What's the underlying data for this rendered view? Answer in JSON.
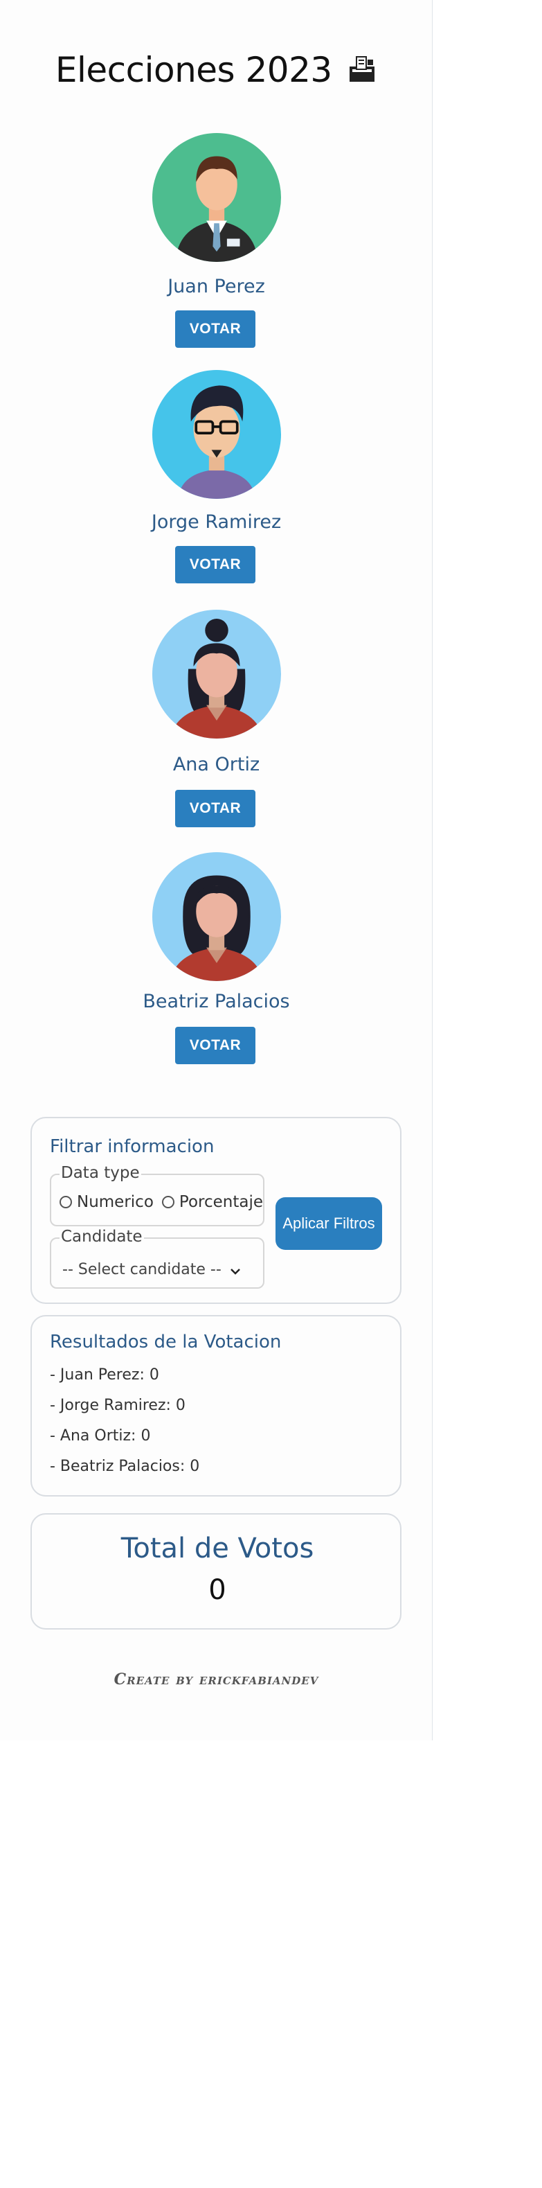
{
  "header": {
    "title": "Elecciones 2023",
    "title_icon": "ballot-box-icon"
  },
  "candidates": [
    {
      "name": "Juan Perez",
      "vote_label": "VOTAR",
      "avatar_bg": "#4dbd8f"
    },
    {
      "name": "Jorge Ramirez",
      "vote_label": "VOTAR",
      "avatar_bg": "#45c4ea"
    },
    {
      "name": "Ana Ortiz",
      "vote_label": "VOTAR",
      "avatar_bg": "#8fd0f5"
    },
    {
      "name": "Beatriz Palacios",
      "vote_label": "VOTAR",
      "avatar_bg": "#8fd0f5"
    }
  ],
  "filter": {
    "title": "Filtrar informacion",
    "data_type_legend": "Data type",
    "options": [
      "Numerico",
      "Porcentaje"
    ],
    "candidate_legend": "Candidate",
    "select_value": "-- Select candidate --",
    "apply_label": "Aplicar Filtros"
  },
  "results": {
    "title": "Resultados de la Votacion",
    "lines": [
      "- Juan Perez: 0",
      "- Jorge Ramirez: 0",
      "- Ana Ortiz: 0",
      "- Beatriz Palacios: 0"
    ]
  },
  "total": {
    "title": "Total de Votos",
    "value": "0"
  },
  "footer": {
    "text": "Create by erickfabiandev"
  },
  "colors": {
    "accent": "#2a7fbf",
    "heading": "#2c5a88"
  }
}
